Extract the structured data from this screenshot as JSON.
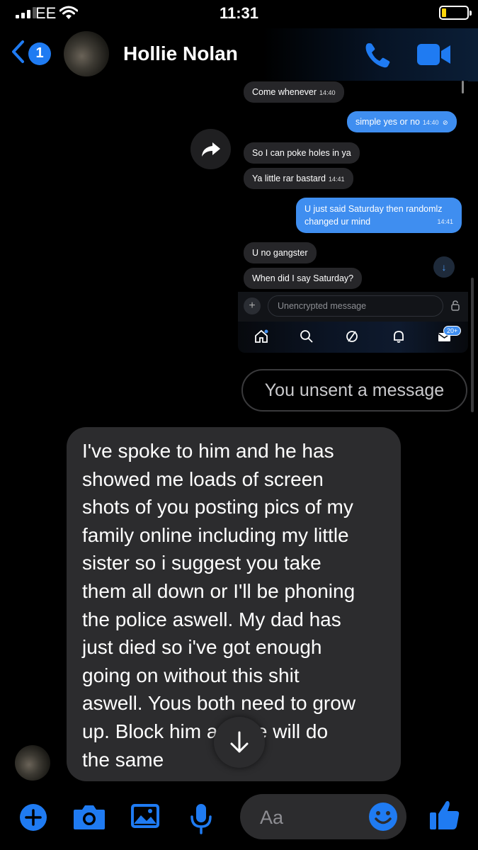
{
  "status_bar": {
    "carrier": "EE",
    "time": "11:31",
    "battery_level": 0.15
  },
  "header": {
    "back_badge": "1",
    "contact_name": "Hollie Nolan",
    "icons": [
      "chevron-left-icon",
      "phone-icon",
      "video-camera-icon"
    ],
    "accent_color": "#1f7bf2"
  },
  "embedded_screenshot": {
    "messages": [
      {
        "direction": "in",
        "text": "Come whenever",
        "time": "14:40"
      },
      {
        "direction": "out",
        "text": "simple yes or no",
        "time": "14:40"
      },
      {
        "direction": "in",
        "text": "So I can poke holes in ya",
        "time": ""
      },
      {
        "direction": "in",
        "text": "Ya little rar bastard",
        "time": "14:41"
      },
      {
        "direction": "out",
        "text": "U just said Saturday then randomlz changed ur mind",
        "line1": "U just said Saturday then randomlz",
        "line2": "changed ur mind",
        "time": "14:41"
      },
      {
        "direction": "in",
        "text": "U no gangster",
        "time": ""
      },
      {
        "direction": "in",
        "text": "When did I say Saturday?",
        "time": ""
      }
    ],
    "input_placeholder": "Unencrypted message",
    "notification_count": "20+"
  },
  "unsent_label": "You unsent a message",
  "big_message": {
    "lines": [
      "I've spoke to him and he has",
      "showed me loads of screen",
      "shots of you posting pics of my",
      "family online including my little",
      "sister so i suggest you take",
      "them all down or I'll be phoning",
      "the police aswell. My dad has",
      "just died so i've got enough",
      "going on without this shit",
      "aswell. Yous both need to grow",
      "up. Block him and he will do",
      "the same"
    ]
  },
  "composer": {
    "placeholder": "Aa",
    "icons": [
      "plus-icon",
      "camera-icon",
      "gallery-icon",
      "microphone-icon",
      "emoji-icon",
      "thumbs-up-icon"
    ]
  }
}
